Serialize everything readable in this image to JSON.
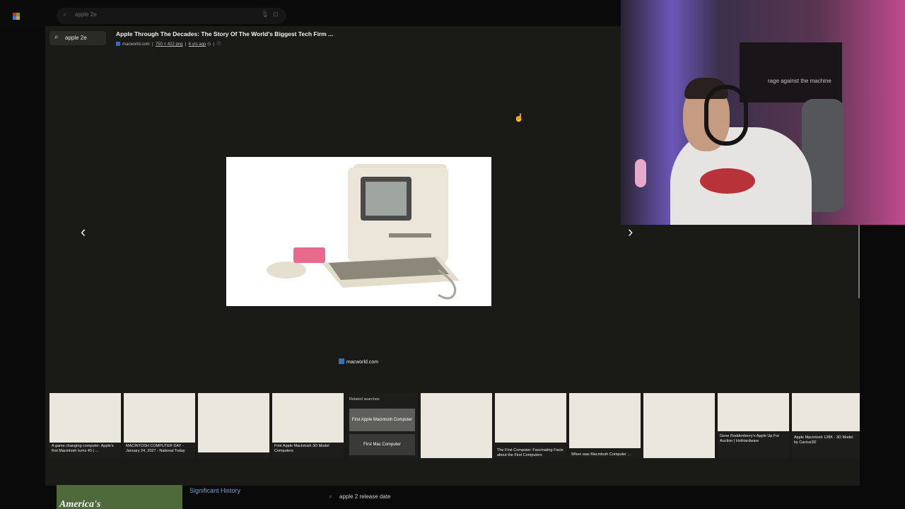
{
  "background_page": {
    "search_query": "apple 2e",
    "section_link": "Significant History",
    "bottom_image_text": "America's",
    "related_query": "apple 2 release date"
  },
  "viewer": {
    "mini_search": "apple 2e",
    "title": "Apple Through The Decades: The Story Of The World's Biggest Tech Firm ...",
    "meta": {
      "site": "macworld.com",
      "dimensions": "750 × 422 png",
      "age": "6 yrs ago"
    },
    "source_badge": "macworld.com",
    "prev_arrow": "‹",
    "next_arrow": "›"
  },
  "thumbnails": [
    {
      "caption": "A game changing computer: Apple's first Macintosh turns 40 | ..."
    },
    {
      "caption": "MACINTOSH COMPUTER DAY - January 24, 2027 - National Today"
    },
    {
      "caption": ""
    },
    {
      "caption": "First Apple Macintosh 3D Model Computers"
    },
    {
      "caption": ""
    },
    {
      "caption": "The First Computer: Fascinating Facts about the First Computers"
    },
    {
      "caption": "When was Macintosh Computer ..."
    },
    {
      "caption": ""
    },
    {
      "caption": "Gene Roddenberry's Apple Up For Auction | HotHardware"
    },
    {
      "caption": "Apple Macintosh 128K - 3D Model by Cactus3D"
    }
  ],
  "related_searches": {
    "header": "Related searches",
    "items": [
      "First Apple Macintosh Computer",
      "First Mac Computer"
    ]
  },
  "webcam": {
    "flag_text": "rage against the machine"
  }
}
